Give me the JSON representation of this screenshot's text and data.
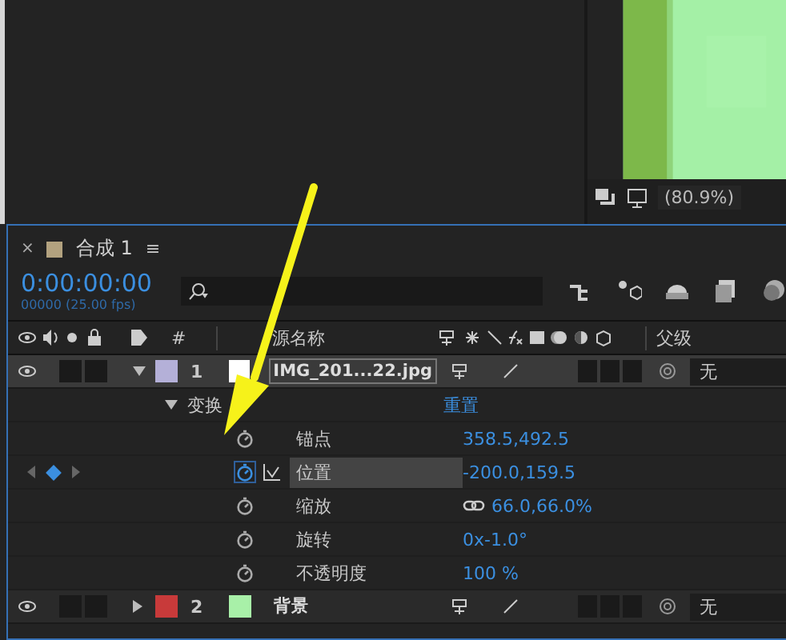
{
  "viewer": {
    "zoom": "(80.9%)"
  },
  "panel": {
    "close": "×",
    "title": "合成 1",
    "menu": "≡",
    "timecode": "0:00:00:00",
    "frame_info": "00000 (25.00 fps)"
  },
  "columns": {
    "number": "#",
    "source_name": "源名称",
    "parent": "父级"
  },
  "layers": [
    {
      "number": "1",
      "name": "IMG_201...22.jpg",
      "color": "#b4b0d8",
      "expanded": true,
      "selected": true,
      "parent": "无",
      "transform": {
        "label": "变换",
        "reset": "重置",
        "expanded": true
      },
      "properties": [
        {
          "name": "锚点",
          "value": "358.5,492.5",
          "keyframed": false,
          "selected": false
        },
        {
          "name": "位置",
          "value": "-200.0,159.5",
          "keyframed": true,
          "selected": true
        },
        {
          "name": "缩放",
          "value": "66.0,66.0%",
          "keyframed": false,
          "selected": false,
          "linked": true
        },
        {
          "name": "旋转",
          "value": "0x-1.0°",
          "keyframed": false,
          "selected": false
        },
        {
          "name": "不透明度",
          "value": "100 %",
          "keyframed": false,
          "selected": false
        }
      ]
    },
    {
      "number": "2",
      "name": "背景",
      "color": "#c83a3a",
      "expanded": false,
      "selected": false,
      "parent": "无"
    }
  ]
}
